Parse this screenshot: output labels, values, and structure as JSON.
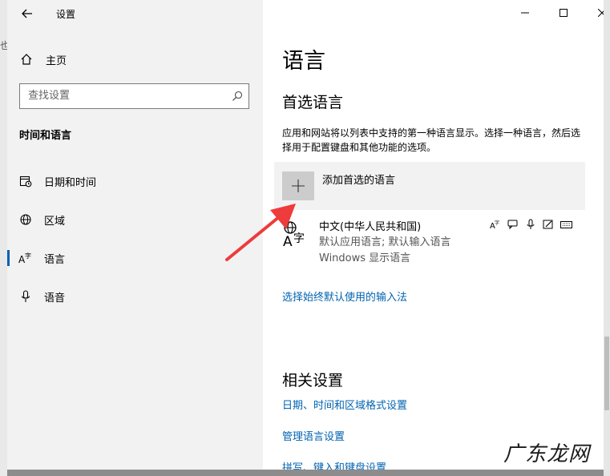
{
  "window": {
    "title": "设置",
    "controls": [
      "minimize",
      "maximize",
      "close"
    ]
  },
  "sidebar": {
    "home_label": "主页",
    "search_placeholder": "查找设置",
    "section_title": "时间和语言",
    "items": [
      {
        "label": "日期和时间",
        "icon": "calendar-clock-icon"
      },
      {
        "label": "区域",
        "icon": "globe-icon"
      },
      {
        "label": "语言",
        "icon": "language-icon",
        "active": true
      },
      {
        "label": "语音",
        "icon": "microphone-icon"
      }
    ]
  },
  "main": {
    "title": "语言",
    "preferred_heading": "首选语言",
    "description": "应用和网站将以列表中支持的第一种语言显示。选择一种语言，然后选择用于配置键盘和其他功能的选项。",
    "add_label": "添加首选的语言",
    "language": {
      "name": "中文(中华人民共和国)",
      "line1": "默认应用语言; 默认输入语言",
      "line2": "Windows 显示语言",
      "feature_icons": [
        "display-language-icon",
        "speech-bubble-icon",
        "microphone-icon",
        "handwriting-icon",
        "keyboard-icon"
      ]
    },
    "input_method_link": "选择始终默认使用的输入法",
    "related_heading": "相关设置",
    "related_links": [
      "日期、时间和区域格式设置",
      "管理语言设置",
      "拼写、键入和键盘设置"
    ]
  },
  "overlay": {
    "watermark": "广东龙网",
    "arrow_color": "#ee3b3b"
  },
  "colors": {
    "accent": "#0063b1",
    "sidebar_bg": "#f2f2f2"
  }
}
